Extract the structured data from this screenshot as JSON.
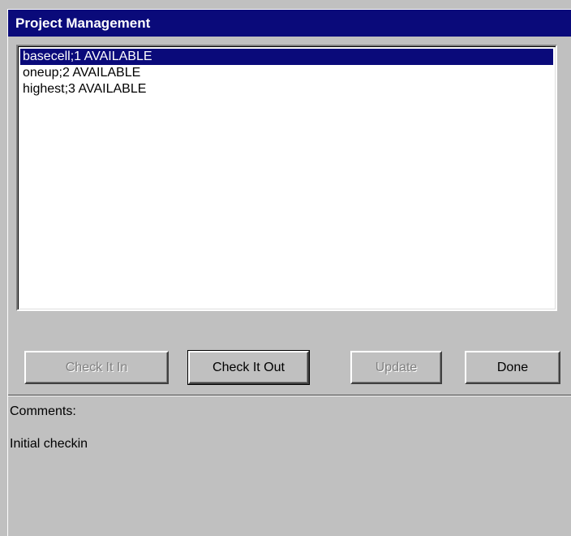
{
  "window": {
    "title": "Project Management"
  },
  "list": {
    "items": [
      {
        "label": "basecell;1 AVAILABLE",
        "selected": true
      },
      {
        "label": "oneup;2 AVAILABLE",
        "selected": false
      },
      {
        "label": "highest;3 AVAILABLE",
        "selected": false
      }
    ]
  },
  "buttons": {
    "check_in": {
      "label": "Check It In",
      "enabled": false
    },
    "check_out": {
      "label": "Check It Out",
      "enabled": true
    },
    "update": {
      "label": "Update",
      "enabled": false
    },
    "done": {
      "label": "Done",
      "enabled": true
    }
  },
  "comments": {
    "label": "Comments:",
    "text": "Initial checkin"
  },
  "colors": {
    "title_bar": "#0a0a7a",
    "selection": "#0a0a7a",
    "face": "#c0c0c0"
  }
}
